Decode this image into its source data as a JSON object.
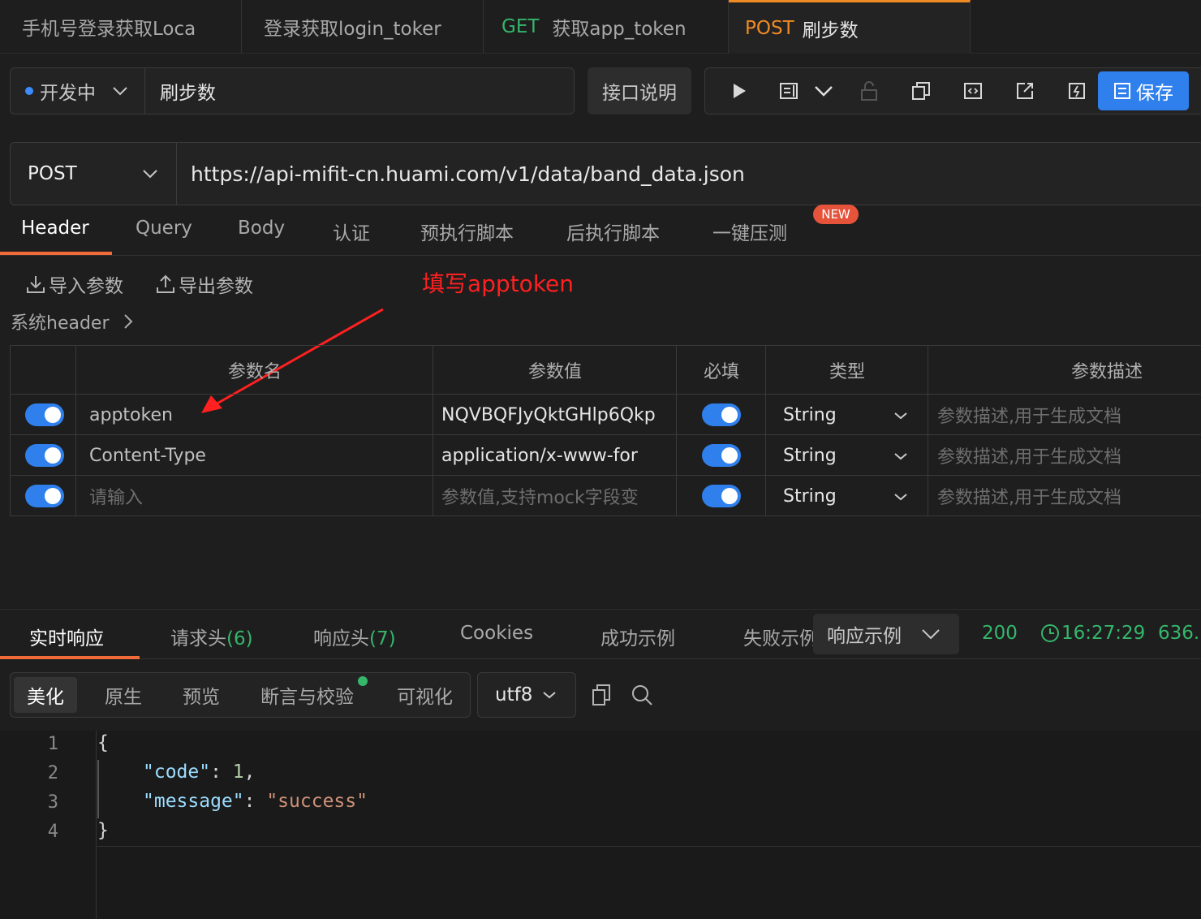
{
  "tabs": [
    {
      "label": "手机号登录获取Loca"
    },
    {
      "label": "登录获取login_toker"
    },
    {
      "method": "GET",
      "label": "获取app_token"
    },
    {
      "method": "POST",
      "label": "刷步数"
    }
  ],
  "env": {
    "selected": "开发中",
    "name": "刷步数"
  },
  "toolbar": {
    "doc_label": "接口说明",
    "save_label": "保存"
  },
  "request": {
    "method": "POST",
    "url": "https://api-mifit-cn.huami.com/v1/data/band_data.json"
  },
  "request_tabs": [
    "Header",
    "Query",
    "Body",
    "认证",
    "预执行脚本",
    "后执行脚本",
    "一键压测"
  ],
  "new_badge": "NEW",
  "import_label": "导入参数",
  "export_label": "导出参数",
  "annotation": "填写apptoken",
  "system_header": "系统header",
  "table": {
    "columns": [
      "参数名",
      "参数值",
      "必填",
      "类型",
      "参数描述"
    ],
    "rows": [
      {
        "name": "apptoken",
        "value": "NQVBQFJyQktGHlp6Qkp",
        "type": "String",
        "desc": "参数描述,用于生成文档"
      },
      {
        "name": "Content-Type",
        "value": "application/x-www-for",
        "type": "String",
        "desc": "参数描述,用于生成文档"
      },
      {
        "name": "请输入",
        "value": "参数值,支持mock字段变",
        "type": "String",
        "desc": "参数描述,用于生成文档"
      }
    ]
  },
  "response": {
    "tabs": [
      "实时响应",
      "请求头",
      "(6)",
      "响应头",
      "(7)",
      "Cookies",
      "成功示例",
      "失败示例"
    ],
    "example_select": "响应示例",
    "status": "200",
    "time": "16:27:29",
    "size": "636.",
    "formats": [
      "美化",
      "原生",
      "预览",
      "断言与校验",
      "可视化"
    ],
    "encoding": "utf8",
    "line_numbers": [
      "1",
      "2",
      "3",
      "4"
    ],
    "json": {
      "open": "{",
      "k1": "\"code\"",
      "v1": "1",
      "k2": "\"message\"",
      "v2": "\"success\"",
      "close": "}"
    }
  }
}
